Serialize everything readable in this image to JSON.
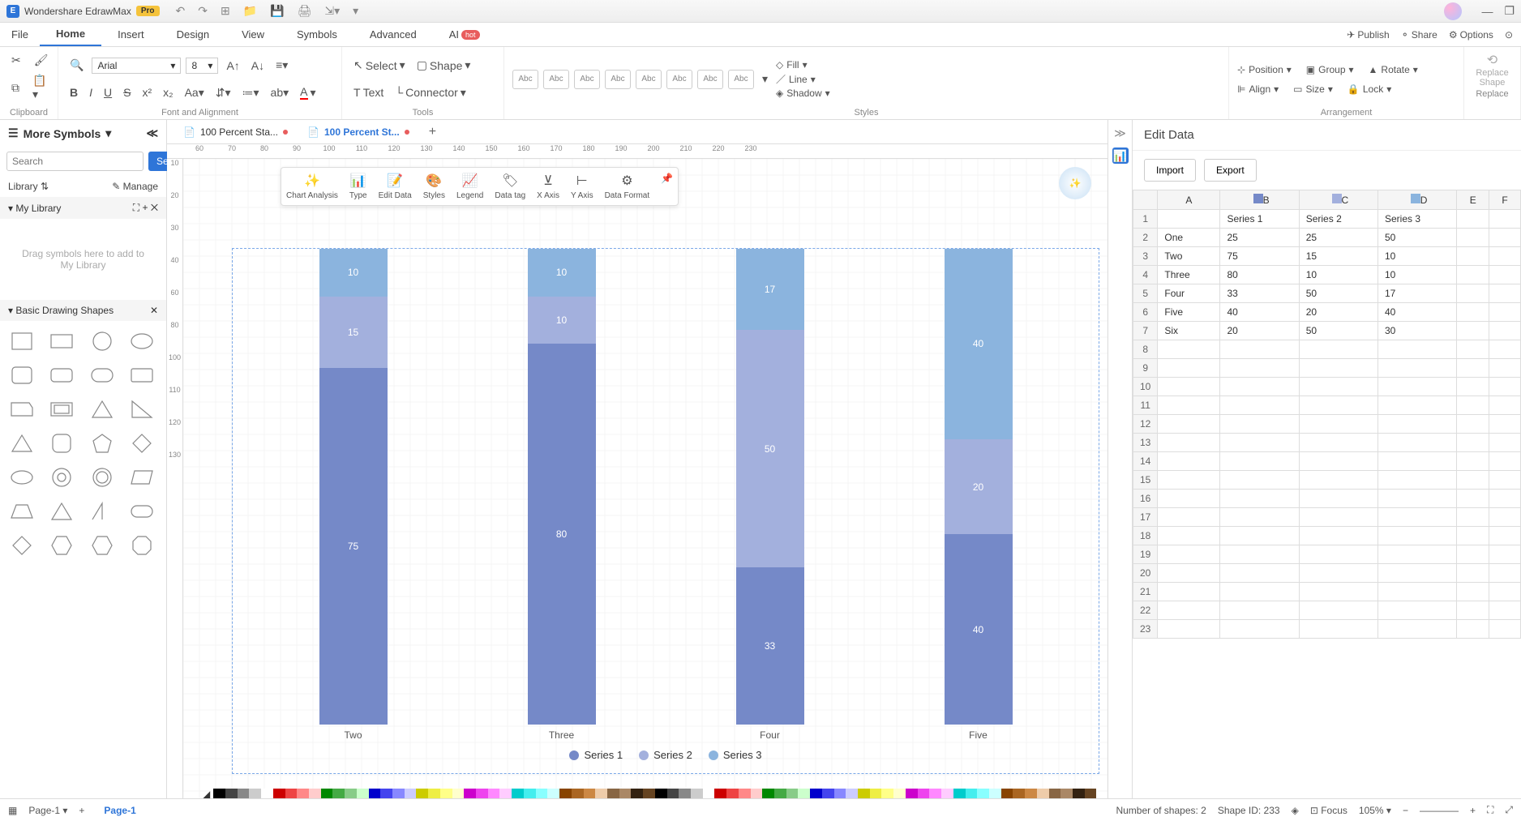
{
  "app": {
    "name": "Wondershare EdrawMax",
    "badge": "Pro"
  },
  "menu": {
    "items": [
      "File",
      "Home",
      "Insert",
      "Design",
      "View",
      "Symbols",
      "Advanced",
      "AI"
    ],
    "active": "Home",
    "right": {
      "publish": "Publish",
      "share": "Share",
      "options": "Options"
    }
  },
  "ribbon": {
    "font": "Arial",
    "size": "8",
    "select": "Select",
    "shape": "Shape",
    "text": "Text",
    "connector": "Connector",
    "fill": "Fill",
    "line": "Line",
    "shadow": "Shadow",
    "position": "Position",
    "group": "Group",
    "rotate": "Rotate",
    "align": "Align",
    "sizeBtn": "Size",
    "lock": "Lock",
    "replaceShape": "Replace Shape",
    "replace": "Replace",
    "groups": {
      "clipboard": "Clipboard",
      "font": "Font and Alignment",
      "tools": "Tools",
      "styles": "Styles",
      "arrangement": "Arrangement"
    }
  },
  "leftPanel": {
    "moreSymbols": "More Symbols",
    "searchPlaceholder": "Search",
    "searchBtn": "Search",
    "library": "Library",
    "manage": "Manage",
    "myLibrary": "My Library",
    "dropHint": "Drag symbols here to add to My Library",
    "basicShapes": "Basic Drawing Shapes"
  },
  "docTabs": {
    "tab1": "100 Percent Sta...",
    "tab2": "100 Percent St..."
  },
  "chartToolbar": {
    "analysis": "Chart Analysis",
    "type": "Type",
    "editData": "Edit Data",
    "styles": "Styles",
    "legend": "Legend",
    "dataTag": "Data tag",
    "xaxis": "X Axis",
    "yaxis": "Y Axis",
    "dataFormat": "Data Format"
  },
  "chart_data": {
    "type": "bar",
    "stacked": true,
    "percent": true,
    "categories": [
      "One",
      "Two",
      "Three",
      "Four",
      "Five",
      "Six"
    ],
    "visible_categories": [
      "Two",
      "Three",
      "Four",
      "Five"
    ],
    "series": [
      {
        "name": "Series 1",
        "values": [
          25,
          75,
          80,
          33,
          40,
          20
        ],
        "color": "#7589c8"
      },
      {
        "name": "Series 2",
        "values": [
          25,
          15,
          10,
          50,
          20,
          50
        ],
        "color": "#a3b0dd"
      },
      {
        "name": "Series 3",
        "values": [
          50,
          10,
          10,
          17,
          40,
          30
        ],
        "color": "#8bb4de"
      }
    ],
    "title": "",
    "xlabel": "",
    "ylabel": ""
  },
  "editData": {
    "title": "Edit Data",
    "import": "Import",
    "export": "Export",
    "cols": [
      "A",
      "B",
      "C",
      "D",
      "E",
      "F"
    ],
    "headerRow": [
      "",
      "Series 1",
      "Series 2",
      "Series 3"
    ],
    "rows": [
      [
        "One",
        "25",
        "25",
        "50"
      ],
      [
        "Two",
        "75",
        "15",
        "10"
      ],
      [
        "Three",
        "80",
        "10",
        "10"
      ],
      [
        "Four",
        "33",
        "50",
        "17"
      ],
      [
        "Five",
        "40",
        "20",
        "40"
      ],
      [
        "Six",
        "20",
        "50",
        "30"
      ]
    ]
  },
  "status": {
    "page": "Page-1",
    "pageTab": "Page-1",
    "numShapes": "Number of shapes: 2",
    "shapeId": "Shape ID: 233",
    "focus": "Focus",
    "zoom": "105%"
  },
  "rulerH": [
    "60",
    "70",
    "80",
    "90",
    "100",
    "110",
    "120",
    "130",
    "140",
    "150",
    "160",
    "170",
    "180",
    "190",
    "200",
    "210",
    "220",
    "230"
  ],
  "rulerV": [
    "10",
    "20",
    "30",
    "40",
    "60",
    "80",
    "100",
    "110",
    "120",
    "130"
  ]
}
